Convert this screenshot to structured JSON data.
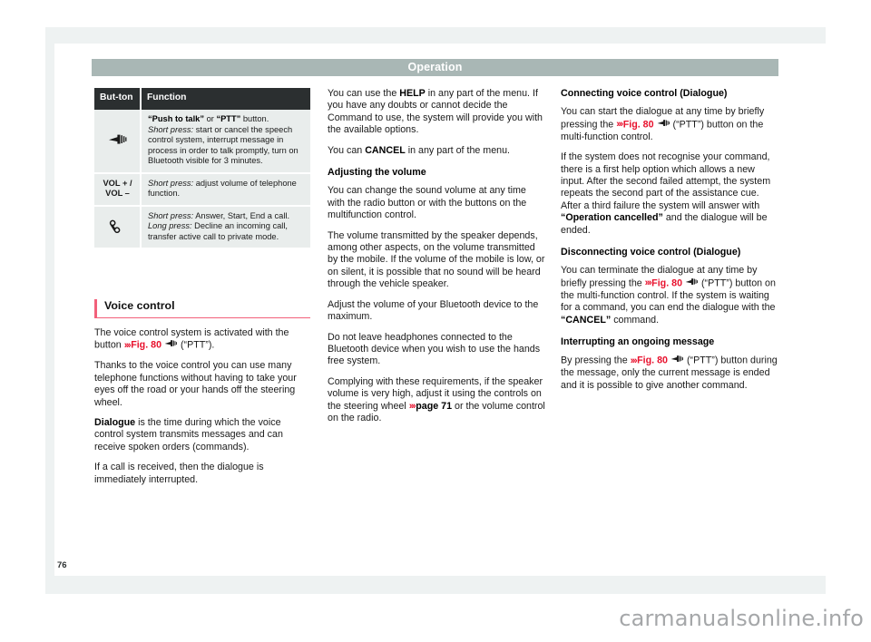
{
  "header": {
    "title": "Operation"
  },
  "folio": {
    "page_number": "76"
  },
  "watermark": {
    "text": "carmanualsonline.info"
  },
  "table": {
    "name": "button-function-table",
    "headers": [
      "But-\nton",
      "Function"
    ],
    "header_button": "But-ton",
    "header_function": "Function",
    "rows": [
      {
        "button_icon": "ptt-speaker-icon",
        "button_label": "",
        "function_segments": [
          {
            "text": "“Push to talk”",
            "style": "bold"
          },
          {
            "text": " or ",
            "style": "normal"
          },
          {
            "text": "“PTT”",
            "style": "bold"
          },
          {
            "text": " button.",
            "style": "normal"
          },
          {
            "text": "\n",
            "style": "break"
          },
          {
            "text": "Short press:",
            "style": "italic"
          },
          {
            "text": " start or cancel the speech control system, interrupt message in process in order to talk promptly, turn on Bluetooth visible for 3 minutes.",
            "style": "normal"
          }
        ]
      },
      {
        "button_icon": "",
        "button_label": "VOL + /\nVOL –",
        "function_segments": [
          {
            "text": "Short press:",
            "style": "italic"
          },
          {
            "text": " adjust volume of telephone function.",
            "style": "normal"
          }
        ]
      },
      {
        "button_icon": "phone-handset-icon",
        "button_label": "",
        "function_segments": [
          {
            "text": "Short press:",
            "style": "italic"
          },
          {
            "text": " Answer, Start, End a call.",
            "style": "normal"
          },
          {
            "text": "\n",
            "style": "break"
          },
          {
            "text": "Long press:",
            "style": "italic"
          },
          {
            "text": " Decline an incoming call, transfer active call to private mode.",
            "style": "normal"
          }
        ]
      }
    ]
  },
  "voice_control": {
    "heading": "Voice control",
    "paragraphs": {
      "p1_a": "The voice control system is activated with the button ",
      "p1_ref": "Fig. 80",
      "p1_b": " (“PTT”).",
      "p2": "Thanks to the voice control you can use many telephone functions without having to take your eyes off the road or your hands off the steering wheel.",
      "p3_bold": "Dialogue",
      "p3_rest": " is the time during which the voice control system transmits messages and can receive spoken orders (commands).",
      "p4": "If a call is received, then the dialogue is immediately interrupted."
    }
  },
  "middle_column": {
    "p1_a": "You can use the ",
    "p1_bold": "HELP",
    "p1_b": " in any part of the menu. If you have any doubts or cannot decide the Command to use, the system will provide you with the available options.",
    "p2_a": "You can ",
    "p2_bold": "CANCEL",
    "p2_b": " in any part of the menu.",
    "subhead_volume": "Adjusting the volume",
    "p3": "You can change the sound volume at any time with the radio button or with the buttons on the multifunction control.",
    "p4": "The volume transmitted by the speaker depends, among other aspects, on the volume transmitted by the mobile. If the volume of the mobile is low, or on silent, it is possible that no sound will be heard through the vehicle speaker.",
    "p5": "Adjust the volume of your Bluetooth device to the maximum.",
    "p6": "Do not leave headphones connected to the Bluetooth device when you wish to use the hands free system.",
    "p7_a": "Complying with these requirements, if the speaker volume is very high, adjust it using the controls on the steering wheel ",
    "p7_ref": "page 71",
    "p7_b": " or the volume control on the radio."
  },
  "right_column": {
    "subhead_connecting": "Connecting voice control (Dialogue)",
    "p1_a": "You can start the dialogue at any time by briefly pressing the ",
    "p1_ref": "Fig. 80",
    "p1_b": " (“PTT”) button on the multi-function control.",
    "p2_a": "If the system does not recognise your command, there is a first help option which allows a new input. After the second failed attempt, the system repeats the second part of the assistance cue. After a third failure the system will answer with ",
    "p2_bold": "“Operation cancelled”",
    "p2_b": " and the dialogue will be ended.",
    "subhead_disconnecting": "Disconnecting voice control (Dialogue)",
    "p3_a": "You can terminate the dialogue at any time by briefly pressing the ",
    "p3_ref": "Fig. 80",
    "p3_b": " (“PTT”) button on the multi-function control. If the system is waiting for a command, you can end the dialogue with the ",
    "p3_bold": "“CANCEL”",
    "p3_c": " command.",
    "subhead_interrupting": "Interrupting an ongoing message",
    "p4_a": "By pressing the ",
    "p4_ref": "Fig. 80",
    "p4_b": " (“PTT”) button during the message, only the current message is ended and it is possible to give another command."
  },
  "colors": {
    "header_band": "#a9b7b5",
    "table_header_bg": "#2b2f30",
    "table_cell_bg": "#e9edec",
    "xref_red": "#e8112d",
    "rule_pink": "#f2607a",
    "page_bg": "#eef2f2"
  },
  "icons": {
    "ptt": "ptt-speaker-icon",
    "phone": "phone-handset-icon",
    "chevrons": "›››"
  }
}
